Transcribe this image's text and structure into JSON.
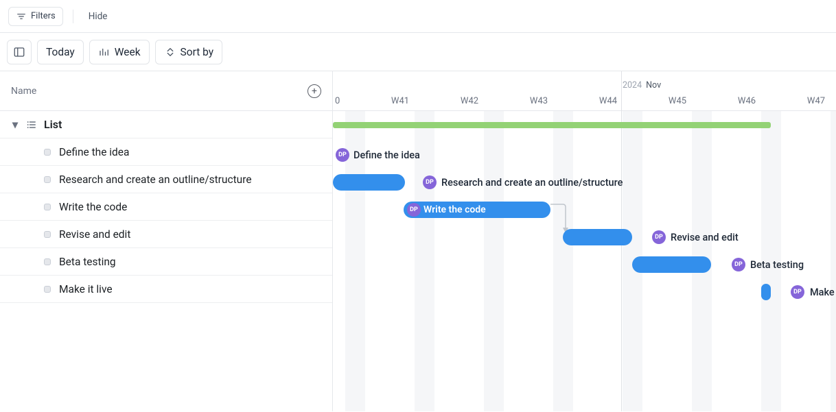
{
  "filterbar": {
    "filters": "Filters",
    "hide": "Hide"
  },
  "toolbar": {
    "today": "Today",
    "week": "Week",
    "sortby": "Sort by"
  },
  "left": {
    "name_header": "Name",
    "group_label": "List",
    "tasks": [
      "Define the idea",
      "Research and create an outline/structure",
      "Write the code",
      "Revise and edit",
      "Beta testing",
      "Make it live"
    ]
  },
  "timeline": {
    "year": "2024",
    "month": "Nov",
    "weeks_first": "0",
    "weeks": [
      "W41",
      "W42",
      "W43",
      "W44",
      "W45",
      "W46",
      "W47"
    ],
    "avatar": "DP",
    "bars": {
      "define": {
        "label": "Define the idea"
      },
      "research": {
        "label": "Research and create an outline/structure"
      },
      "write": {
        "label": "Write the code"
      },
      "revise": {
        "label": "Revise and edit"
      },
      "beta": {
        "label": "Beta testing"
      },
      "live": {
        "label": "Make"
      }
    }
  }
}
